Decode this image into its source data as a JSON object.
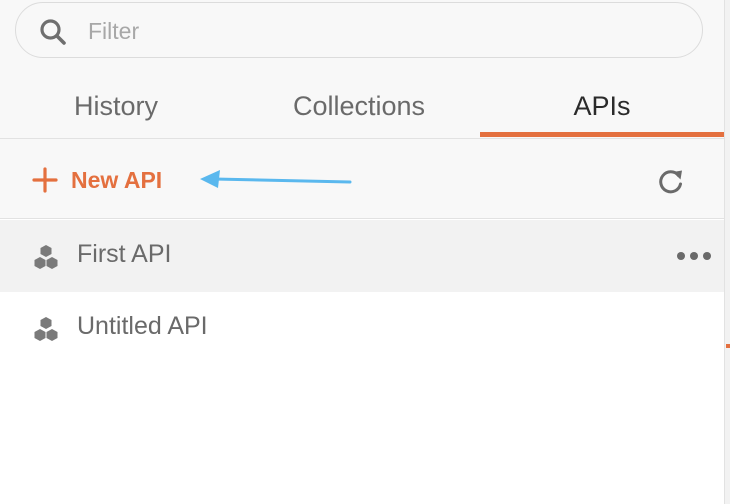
{
  "search": {
    "placeholder": "Filter",
    "icon": "search-icon"
  },
  "tabs": [
    {
      "label": "History",
      "active": false
    },
    {
      "label": "Collections",
      "active": false
    },
    {
      "label": "APIs",
      "active": true
    }
  ],
  "toolbar": {
    "new_api_label": "New API",
    "new_api_icon": "plus-icon",
    "refresh_icon": "refresh-icon"
  },
  "apis": [
    {
      "name": "First API",
      "selected": true,
      "icon": "api-hex-icon"
    },
    {
      "name": "Untitled API",
      "selected": false,
      "icon": "api-hex-icon"
    }
  ],
  "colors": {
    "accent": "#e4703f",
    "annotation_arrow": "#5ab8ee",
    "text": "#6a6a6a",
    "active_tab_text": "#2b2b2b",
    "panel_bg": "#f8f8f8",
    "selected_row_bg": "#f2f2f2"
  }
}
